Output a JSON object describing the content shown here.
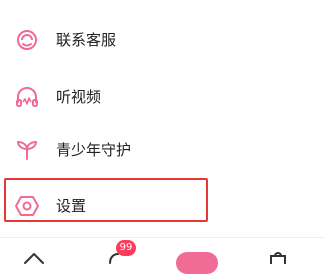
{
  "colors": {
    "accent": "#f06b96",
    "highlight_border": "#e53935",
    "badge": "#ff3b5c"
  },
  "menu": {
    "items": [
      {
        "label": "联系客服",
        "icon": "headset-icon"
      },
      {
        "label": "听视频",
        "icon": "headphones-icon"
      },
      {
        "label": "青少年守护",
        "icon": "sprout-icon"
      },
      {
        "label": "设置",
        "icon": "settings-hexagon-icon"
      }
    ]
  },
  "tabbar": {
    "messages_badge": "99",
    "icons": [
      "home-icon",
      "messages-icon",
      "center-tab-icon",
      "shop-icon"
    ]
  }
}
